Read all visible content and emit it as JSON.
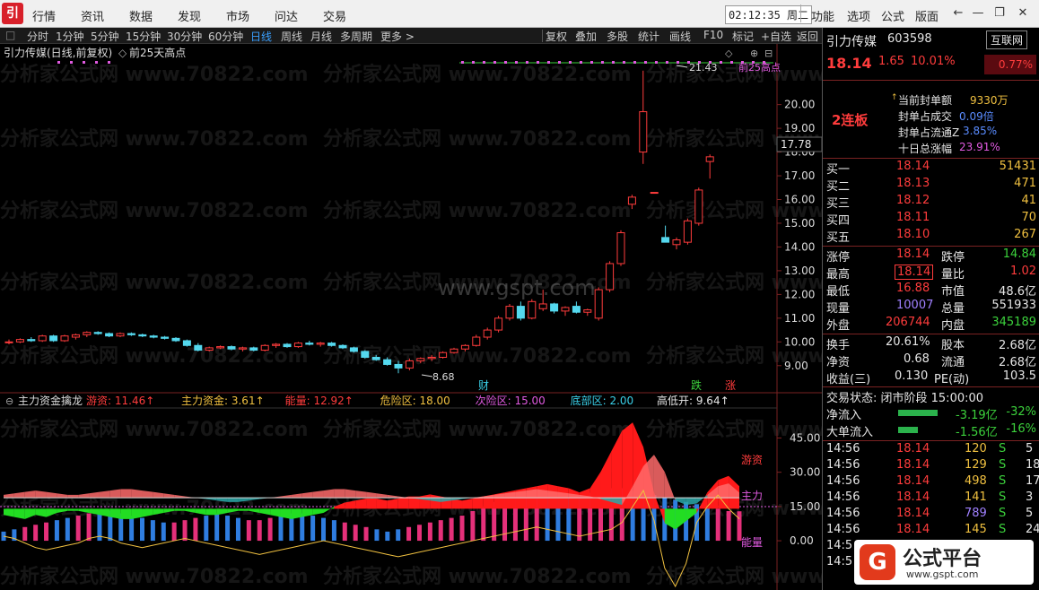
{
  "menubar": {
    "logo": "引",
    "items": [
      "行情",
      "资讯",
      "数据",
      "发现",
      "市场",
      "问达",
      "交易"
    ],
    "clock": "02:12:35 周二",
    "right_items": [
      "功能",
      "选项",
      "公式",
      "版面"
    ]
  },
  "tabs": {
    "periods": [
      "分时",
      "1分钟",
      "5分钟",
      "15分钟",
      "30分钟",
      "60分钟",
      "日线",
      "周线",
      "月线",
      "多周期",
      "更多 >"
    ],
    "active": "日线",
    "tools": [
      "复权",
      "叠加",
      "多股",
      "统计",
      "画线",
      "F10",
      "标记",
      "+自选",
      "返回"
    ]
  },
  "chart": {
    "title": "引力传媒(日线,前复权)",
    "high_label": "前25天高点",
    "high_label_right": "前25高点",
    "peak_value": "21.43",
    "low_value": "8.68",
    "current_price": "17.78",
    "cai_marker": "财",
    "die_marker": "跌",
    "zhang_marker": "涨",
    "watermark_site": "www.gspt.com",
    "watermark_text": "分析家公式网 www.70822.com",
    "price_axis": [
      "20.00",
      "19.00",
      "18.00",
      "17.00",
      "16.00",
      "15.00",
      "14.00",
      "13.00",
      "12.00",
      "11.00",
      "10.00",
      "9.00"
    ],
    "indicator": {
      "name": "主力资金擒龙",
      "items": [
        {
          "label": "游资: 11.46↑",
          "color": "#ff3c3c"
        },
        {
          "label": "主力资金: 3.61↑",
          "color": "#f0c040"
        },
        {
          "label": "能量: 12.92↑",
          "color": "#ff3c3c"
        },
        {
          "label": "危险区: 18.00",
          "color": "#f0c040"
        },
        {
          "label": "次险区: 15.00",
          "color": "#e05ae0"
        },
        {
          "label": "底部区: 2.00",
          "color": "#3ad0e8"
        },
        {
          "label": "高低开: 9.64↑",
          "color": "#e6e6e6"
        }
      ],
      "axis": [
        "45.00",
        "30.00",
        "15.00",
        "0.00"
      ],
      "series_tags": [
        "游资",
        "主力",
        "能量"
      ]
    }
  },
  "chart_data": {
    "type": "candlestick",
    "price_ylim": [
      8.5,
      21.8
    ],
    "candles": [
      [
        10.0,
        10.1,
        9.9,
        10.0
      ],
      [
        10.0,
        10.15,
        9.95,
        10.1
      ],
      [
        10.1,
        10.2,
        10.0,
        10.05
      ],
      [
        10.05,
        10.3,
        10.0,
        10.25
      ],
      [
        10.25,
        10.3,
        10.0,
        10.05
      ],
      [
        10.05,
        10.3,
        10.0,
        10.25
      ],
      [
        10.2,
        10.35,
        10.1,
        10.3
      ],
      [
        10.3,
        10.45,
        10.2,
        10.4
      ],
      [
        10.4,
        10.45,
        10.3,
        10.35
      ],
      [
        10.35,
        10.4,
        10.2,
        10.25
      ],
      [
        10.25,
        10.4,
        10.2,
        10.35
      ],
      [
        10.35,
        10.4,
        10.25,
        10.3
      ],
      [
        10.3,
        10.35,
        10.2,
        10.25
      ],
      [
        10.25,
        10.3,
        10.15,
        10.2
      ],
      [
        10.2,
        10.25,
        10.1,
        10.15
      ],
      [
        10.15,
        10.2,
        10.0,
        10.05
      ],
      [
        10.05,
        10.1,
        9.8,
        9.85
      ],
      [
        9.85,
        9.95,
        9.6,
        9.65
      ],
      [
        9.65,
        9.8,
        9.6,
        9.75
      ],
      [
        9.75,
        9.85,
        9.7,
        9.8
      ],
      [
        9.8,
        9.85,
        9.65,
        9.7
      ],
      [
        9.7,
        9.8,
        9.6,
        9.75
      ],
      [
        9.75,
        9.8,
        9.6,
        9.65
      ],
      [
        9.65,
        9.9,
        9.6,
        9.85
      ],
      [
        9.85,
        9.95,
        9.75,
        9.9
      ],
      [
        9.9,
        9.95,
        9.75,
        9.8
      ],
      [
        9.8,
        10.0,
        9.75,
        9.95
      ],
      [
        9.95,
        10.05,
        9.85,
        9.9
      ],
      [
        9.9,
        10.0,
        9.8,
        9.95
      ],
      [
        9.95,
        10.0,
        9.8,
        9.85
      ],
      [
        9.85,
        9.9,
        9.7,
        9.75
      ],
      [
        9.75,
        9.8,
        9.55,
        9.6
      ],
      [
        9.6,
        9.65,
        9.3,
        9.35
      ],
      [
        9.35,
        9.45,
        9.2,
        9.25
      ],
      [
        9.25,
        9.35,
        9.0,
        9.05
      ],
      [
        9.05,
        9.2,
        8.68,
        8.9
      ],
      [
        8.9,
        9.3,
        8.8,
        9.2
      ],
      [
        9.2,
        9.35,
        9.1,
        9.3
      ],
      [
        9.3,
        9.45,
        9.2,
        9.35
      ],
      [
        9.35,
        9.6,
        9.3,
        9.55
      ],
      [
        9.55,
        9.75,
        9.5,
        9.7
      ],
      [
        9.7,
        9.9,
        9.6,
        9.85
      ],
      [
        9.85,
        10.3,
        9.8,
        10.2
      ],
      [
        10.2,
        10.6,
        10.1,
        10.5
      ],
      [
        10.5,
        11.1,
        10.4,
        11.0
      ],
      [
        11.0,
        11.6,
        10.9,
        11.5
      ],
      [
        11.5,
        11.7,
        10.9,
        11.0
      ],
      [
        11.0,
        11.8,
        10.95,
        11.7
      ],
      [
        11.4,
        12.2,
        11.3,
        11.6
      ],
      [
        11.6,
        11.65,
        11.2,
        11.3
      ],
      [
        11.3,
        11.5,
        11.1,
        11.45
      ],
      [
        11.5,
        11.7,
        11.2,
        11.25
      ],
      [
        11.25,
        11.4,
        11.1,
        11.35
      ],
      [
        11.0,
        12.3,
        10.9,
        12.2
      ],
      [
        12.2,
        13.4,
        12.1,
        13.3
      ],
      [
        13.3,
        14.7,
        13.2,
        14.6
      ],
      [
        15.8,
        16.2,
        15.6,
        16.1
      ],
      [
        18.0,
        21.43,
        17.5,
        19.7
      ],
      [
        16.3,
        16.3,
        16.3,
        16.3
      ],
      [
        14.4,
        14.9,
        14.2,
        14.2
      ],
      [
        14.1,
        14.4,
        13.9,
        14.3
      ],
      [
        14.2,
        15.2,
        14.1,
        15.1
      ],
      [
        15.0,
        16.5,
        14.9,
        16.4
      ],
      [
        17.6,
        17.9,
        16.88,
        17.8
      ]
    ],
    "indicator_ylim": [
      -20,
      55
    ],
    "youzi_series": [
      -3,
      -4,
      -5,
      -3,
      -4,
      -2,
      -1,
      -1,
      -2,
      -3,
      -4,
      -5,
      -5,
      -4,
      -3,
      -2,
      -1,
      -1,
      -2,
      -3,
      -3,
      -2,
      -1,
      -1,
      -2,
      -3,
      -4,
      -5,
      -4,
      -3,
      -2,
      1,
      3,
      4,
      5,
      5,
      4,
      5,
      6,
      6,
      7,
      6,
      5,
      4,
      5,
      6,
      7,
      8,
      9,
      10,
      11,
      12,
      11,
      10,
      8,
      10,
      18,
      28,
      38,
      42,
      30,
      8,
      -7,
      -10,
      -6,
      -2,
      8,
      14,
      16,
      11
    ],
    "zhuli_series": [
      2,
      3,
      4,
      5,
      4,
      3,
      2,
      2,
      3,
      4,
      5,
      6,
      6,
      5,
      4,
      3,
      2,
      1,
      0,
      -1,
      -2,
      -3,
      -3,
      -2,
      -1,
      0,
      1,
      2,
      3,
      4,
      5,
      6,
      6,
      5,
      4,
      3,
      2,
      1,
      0,
      -1,
      -2,
      -3,
      -2,
      -1,
      0,
      1,
      2,
      3,
      4,
      5,
      6,
      5,
      4,
      3,
      2,
      1,
      -1,
      -3,
      -5,
      8,
      22,
      30,
      18,
      -2,
      -5,
      -4,
      2,
      8,
      10,
      3.6
    ],
    "energy_series": [
      4,
      5,
      6,
      7,
      8,
      9,
      10,
      11,
      12,
      13,
      13,
      12,
      11,
      10,
      9,
      8,
      8,
      9,
      10,
      11,
      12,
      11,
      10,
      9,
      9,
      10,
      11,
      12,
      12,
      11,
      10,
      9,
      8,
      7,
      6,
      5,
      4,
      5,
      6,
      7,
      8,
      9,
      10,
      11,
      13,
      15,
      17,
      19,
      20,
      21,
      22,
      21,
      20,
      19,
      20,
      21,
      22,
      23,
      23,
      22,
      21,
      20,
      19,
      18,
      17,
      16,
      15,
      14,
      13,
      12.9
    ],
    "energy_up": [
      false,
      false,
      true,
      true,
      true,
      false,
      false,
      true,
      true,
      false,
      false,
      false,
      false,
      false,
      false,
      false,
      true,
      true,
      true,
      false,
      false,
      false,
      false,
      true,
      true,
      true,
      false,
      false,
      false,
      false,
      false,
      false,
      true,
      true,
      true,
      false,
      false,
      false,
      true,
      true,
      true,
      true,
      true,
      true,
      true,
      true,
      true,
      true,
      true,
      true,
      true,
      false,
      false,
      false,
      true,
      true,
      true,
      true,
      true,
      false,
      false,
      false,
      false,
      false,
      false,
      false,
      false,
      true,
      true,
      true
    ],
    "gaodikai_line": [
      2,
      1,
      -1,
      -3,
      -4,
      -3,
      -2,
      -1,
      1,
      2,
      1,
      -1,
      -2,
      -3,
      -2,
      -1,
      0,
      1,
      0,
      -1,
      -2,
      -3,
      -4,
      -5,
      -6,
      -5,
      -4,
      -3,
      -2,
      -1,
      0,
      -1,
      -2,
      -3,
      -4,
      -5,
      -6,
      -7,
      -6,
      -5,
      -4,
      -3,
      -2,
      -1,
      0,
      1,
      2,
      3,
      4,
      5,
      6,
      5,
      4,
      3,
      2,
      3,
      4,
      5,
      8,
      15,
      22,
      9,
      -12,
      -20,
      -10,
      8,
      15,
      20,
      14,
      9.6
    ]
  },
  "panel": {
    "stock_name": "引力传媒",
    "code": "603598",
    "tag": "互联网",
    "price": "18.14",
    "change": "1.65",
    "pct": "10.01%",
    "tag_pct": "0.77%",
    "lianban": "2连板",
    "seal": [
      {
        "k": "当前封单额",
        "v": "9330万",
        "c": "yellow"
      },
      {
        "k": "封单占成交",
        "v": "0.09倍",
        "c": "blue"
      },
      {
        "k": "封单占流通Z",
        "v": "3.85%",
        "c": "blue"
      },
      {
        "k": "十日总涨幅",
        "v": "23.91%",
        "c": "magenta"
      }
    ],
    "bids": [
      {
        "k": "买一",
        "p": "18.14",
        "v": "51431"
      },
      {
        "k": "买二",
        "p": "18.13",
        "v": "471"
      },
      {
        "k": "买三",
        "p": "18.12",
        "v": "41"
      },
      {
        "k": "买四",
        "p": "18.11",
        "v": "70"
      },
      {
        "k": "买五",
        "p": "18.10",
        "v": "267"
      }
    ],
    "stats": [
      {
        "k1": "涨停",
        "v1": "18.14",
        "c1": "red",
        "k2": "跌停",
        "v2": "14.84",
        "c2": "green"
      },
      {
        "k1": "最高",
        "v1": "18.14",
        "c1": "red",
        "k2": "量比",
        "v2": "1.02",
        "c2": "red"
      },
      {
        "k1": "最低",
        "v1": "16.88",
        "c1": "red",
        "k2": "市值",
        "v2": "48.6亿",
        "c2": "white"
      },
      {
        "k1": "现量",
        "v1": "10007",
        "c1": "purple",
        "k2": "总量",
        "v2": "551933",
        "c2": "white"
      },
      {
        "k1": "外盘",
        "v1": "206744",
        "c1": "red",
        "k2": "内盘",
        "v2": "345189",
        "c2": "green"
      }
    ],
    "stats2": [
      {
        "k1": "换手",
        "v1": "20.61%",
        "k2": "股本",
        "v2": "2.68亿"
      },
      {
        "k1": "净资",
        "v1": "0.68",
        "k2": "流通",
        "v2": "2.68亿"
      },
      {
        "k1": "收益(三)",
        "v1": "0.130",
        "k2": "PE(动)",
        "v2": "103.5"
      }
    ],
    "trade_state": "交易状态: 闭市阶段 15:00:00",
    "flows": [
      {
        "k": "净流入",
        "v": "-3.19亿",
        "p": "-32%"
      },
      {
        "k": "大单流入",
        "v": "-1.56亿",
        "p": "-16%"
      }
    ],
    "ticks": [
      {
        "t": "14:56",
        "p": "18.14",
        "v": "120",
        "d": "S",
        "n": "5",
        "vc": "yellow"
      },
      {
        "t": "14:56",
        "p": "18.14",
        "v": "129",
        "d": "S",
        "n": "18",
        "vc": "yellow"
      },
      {
        "t": "14:56",
        "p": "18.14",
        "v": "498",
        "d": "S",
        "n": "17",
        "vc": "yellow"
      },
      {
        "t": "14:56",
        "p": "18.14",
        "v": "141",
        "d": "S",
        "n": "3",
        "vc": "yellow"
      },
      {
        "t": "14:56",
        "p": "18.14",
        "v": "789",
        "d": "S",
        "n": "5",
        "vc": "purple"
      },
      {
        "t": "14:56",
        "p": "18.14",
        "v": "145",
        "d": "S",
        "n": "24",
        "vc": "yellow"
      },
      {
        "t": "14:5",
        "p": "",
        "v": "",
        "d": "",
        "n": "",
        "vc": "yellow"
      },
      {
        "t": "14:5",
        "p": "",
        "v": "",
        "d": "",
        "n": "",
        "vc": "yellow"
      }
    ],
    "badge_title": "公式平台",
    "badge_url": "www.gspt.com"
  }
}
